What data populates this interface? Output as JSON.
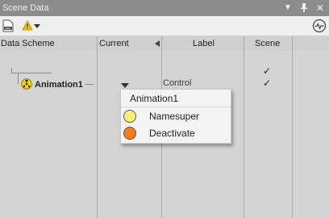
{
  "window": {
    "title": "Scene Data"
  },
  "toolbar": {
    "xml_icon": "xml-file-icon",
    "warning_icon": "warning-icon",
    "activity_icon": "activity-icon"
  },
  "columns": {
    "data_scheme": "Data Scheme",
    "current": "Current",
    "label": "Label",
    "scene": "Scene"
  },
  "rows": [
    {
      "name": "",
      "scene_check": "✓"
    },
    {
      "name": "Animation1",
      "label": "Control",
      "scene_check": "✓"
    }
  ],
  "popup": {
    "title": "Animation1",
    "items": [
      {
        "label": "Namesuper",
        "color": "#fff176"
      },
      {
        "label": "Deactivate",
        "color": "#ff7a1a"
      }
    ]
  },
  "colors": {
    "title_bar": "#8c8c8c",
    "background": "#d4d4d4",
    "warning": "#f5c400"
  }
}
